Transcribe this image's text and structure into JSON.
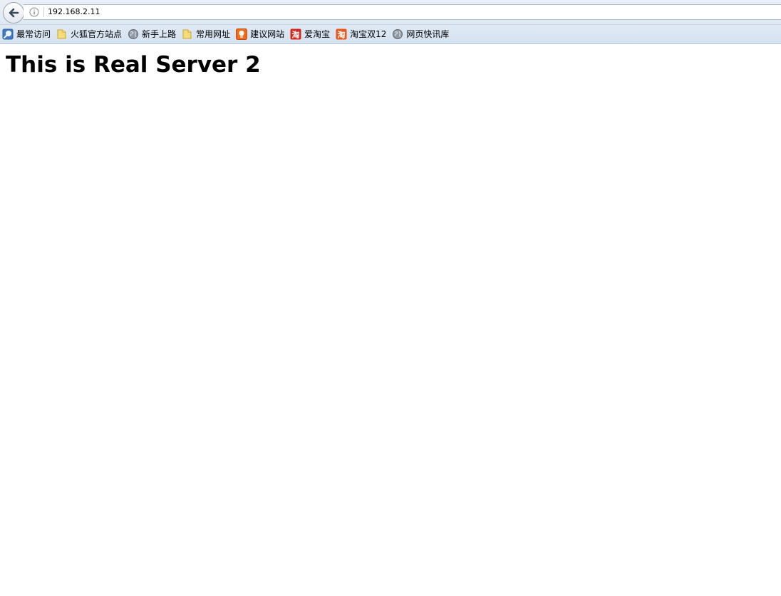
{
  "navbar": {
    "url": "192.168.2.11",
    "back_icon": "back-arrow-icon",
    "info_icon": "info-icon"
  },
  "bookmarks": {
    "items": [
      {
        "label": "最常访问",
        "icon": "magnifier-icon"
      },
      {
        "label": "火狐官方站点",
        "icon": "folder-icon"
      },
      {
        "label": "新手上路",
        "icon": "globe-icon"
      },
      {
        "label": "常用网址",
        "icon": "folder-icon"
      },
      {
        "label": "建议网站",
        "icon": "lightbulb-icon"
      },
      {
        "label": "爱淘宝",
        "icon": "taobao-icon"
      },
      {
        "label": "淘宝双12",
        "icon": "taobao-icon"
      },
      {
        "label": "网页快讯库",
        "icon": "globe-icon"
      }
    ]
  },
  "page": {
    "heading": "This is Real Server 2"
  },
  "colors": {
    "toolbar_bg": "#dfe8f3",
    "bookmarks_bg": "#d6e2f0",
    "taobao_red": "#d7271c",
    "taobao_orange": "#e8561a",
    "folder_yellow": "#f3d56b",
    "lightbulb_orange": "#f26b1d"
  }
}
